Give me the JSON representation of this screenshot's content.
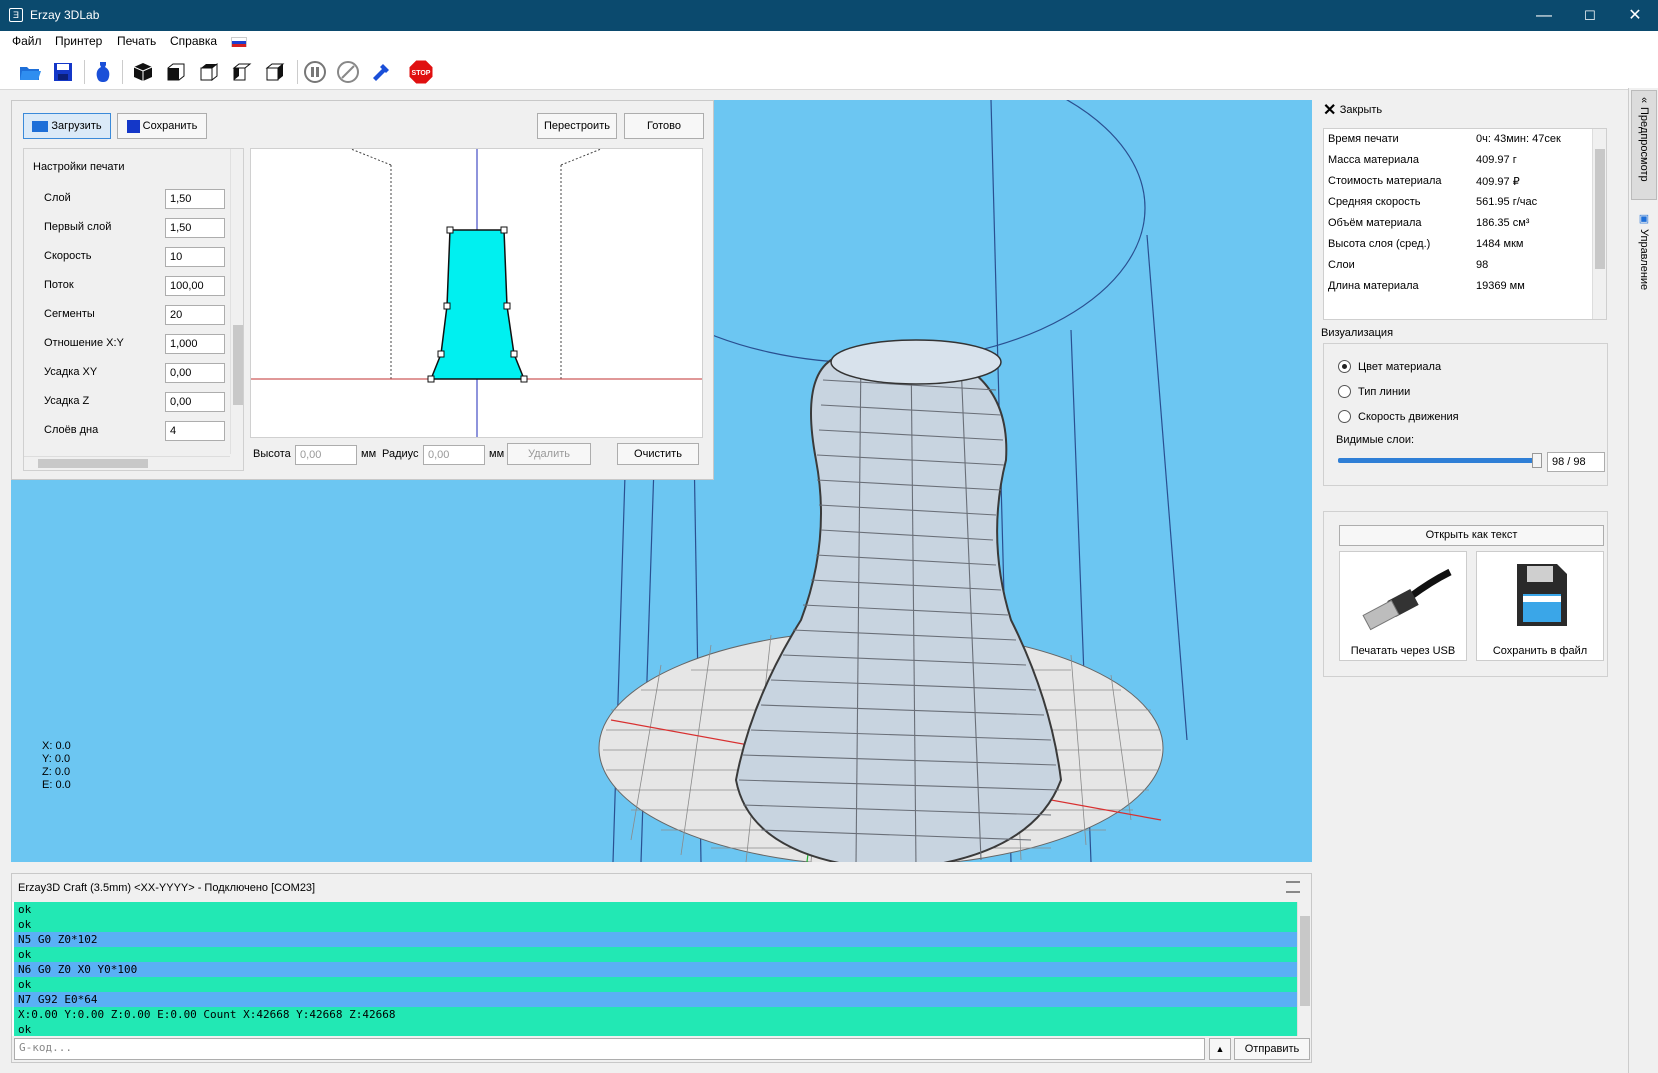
{
  "window": {
    "title": "Erzay 3DLab",
    "app_icon": "app-logo-icon",
    "minimize": "—",
    "maximize": "☐",
    "close": "✕"
  },
  "menu": {
    "items": [
      "Файл",
      "Принтер",
      "Печать",
      "Справка"
    ],
    "language_icon": "russian-flag-icon"
  },
  "toolbar": {
    "icons": [
      "open-folder-icon",
      "save-disk-icon",
      "vase-icon",
      "cube-view-icon",
      "cube-front-icon",
      "cube-top-icon",
      "cube-left-icon",
      "cube-right-icon",
      "pause-icon",
      "cancel-icon",
      "gear-tool-icon",
      "stop-icon"
    ],
    "stop_label": "STOP"
  },
  "editor": {
    "load_button": "Загрузить",
    "save_button": "Сохранить",
    "rebuild_button": "Перестроить",
    "done_button": "Готово",
    "settings_title": "Настройки печати",
    "settings": [
      {
        "label": "Слой",
        "value": "1,50"
      },
      {
        "label": "Первый слой",
        "value": "1,50"
      },
      {
        "label": "Скорость",
        "value": "10"
      },
      {
        "label": "Поток",
        "value": "100,00"
      },
      {
        "label": "Сегменты",
        "value": "20"
      },
      {
        "label": "Отношение X:Y",
        "value": "1,000"
      },
      {
        "label": "Усадка XY",
        "value": "0,00"
      },
      {
        "label": "Усадка Z",
        "value": "0,00"
      },
      {
        "label": "Слоёв дна",
        "value": "4"
      }
    ],
    "height_label": "Высота",
    "height_value": "0,00",
    "unit_mm": "мм",
    "radius_label": "Радиус",
    "radius_value": "0,00",
    "unit_mm2": "мм",
    "delete_button": "Удалить",
    "clear_button": "Очистить"
  },
  "viewport": {
    "coords": [
      "X: 0.0",
      "Y: 0.0",
      "Z: 0.0",
      "E: 0.0"
    ],
    "background": "#6cc6f2"
  },
  "right_panel": {
    "close_label": "Закрыть",
    "stats": [
      {
        "k": "Время печати",
        "v": "0ч: 43мин: 47сек"
      },
      {
        "k": "Масса материала",
        "v": "409.97 г"
      },
      {
        "k": "Стоимость материала",
        "v": "409.97 ₽"
      },
      {
        "k": "Средняя скорость",
        "v": "561.95 г/час"
      },
      {
        "k": "Объём материала",
        "v": "186.35 см³"
      },
      {
        "k": "Высота слоя (сред.)",
        "v": "1484 мкм"
      },
      {
        "k": "Слои",
        "v": "98"
      },
      {
        "k": "Длина материала",
        "v": "19369 мм"
      }
    ],
    "visualization_title": "Визуализация",
    "radios": [
      {
        "label": "Цвет материала",
        "checked": true
      },
      {
        "label": "Тип линии",
        "checked": false
      },
      {
        "label": "Скорость движения",
        "checked": false
      }
    ],
    "visible_layers_label": "Видимые слои:",
    "visible_layers_value": "98 / 98",
    "layers_fraction": 1.0,
    "open_as_text": "Открыть как текст",
    "print_usb": "Печатать через USB",
    "save_file": "Сохранить в файл"
  },
  "side_tabs": {
    "preview": "Предпросмотр",
    "control": "Управление"
  },
  "console": {
    "title": "Erzay3D Craft (3.5mm) <XX-YYYY> - Подключено [COM23]",
    "lines": [
      {
        "text": "ok",
        "type": "resp"
      },
      {
        "text": "ok",
        "type": "resp"
      },
      {
        "text": "N5 G0 Z0*102",
        "type": "cmd"
      },
      {
        "text": "ok",
        "type": "resp"
      },
      {
        "text": "N6 G0 Z0 X0 Y0*100",
        "type": "cmd"
      },
      {
        "text": "ok",
        "type": "resp"
      },
      {
        "text": "N7 G92 E0*64",
        "type": "cmd"
      },
      {
        "text": "X:0.00 Y:0.00 Z:0.00 E:0.00 Count X:42668 Y:42668 Z:42668",
        "type": "resp"
      },
      {
        "text": "ok",
        "type": "resp"
      }
    ],
    "colors": {
      "resp": "#22e8b4",
      "cmd": "#5ab0f5"
    },
    "input_placeholder": "G-код...",
    "send_button": "Отправить"
  }
}
